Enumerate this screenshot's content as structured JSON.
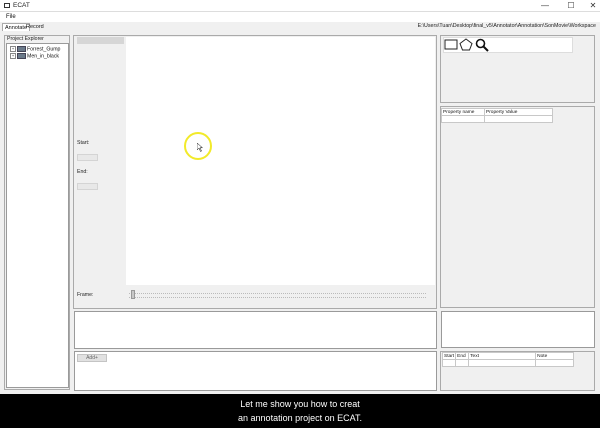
{
  "window": {
    "title": "ECAT",
    "minimize_glyph": "—",
    "maximize_glyph": "☐",
    "close_glyph": "✕"
  },
  "menu": {
    "file": "File"
  },
  "tabs": [
    {
      "label": "Annotate"
    },
    {
      "label": "Record"
    }
  ],
  "workspace_path": "E:\\Users\\Tuan\\Desktop\\final_v5\\Annotator\\Annotation\\SonMovie\\Workspace",
  "project_explorer": {
    "title": "Project Explorer",
    "items": [
      {
        "label": "Forrest_Gump"
      },
      {
        "label": "Men_in_black"
      }
    ]
  },
  "video": {
    "start_label": "Start:",
    "end_label": "End:",
    "frame_label": "Frame:"
  },
  "tools": {
    "icons": [
      "rectangle-icon",
      "polygon-icon",
      "zoom-icon"
    ]
  },
  "properties": {
    "columns": [
      "Property name",
      "Property Value"
    ]
  },
  "annotations": {
    "add_button": "Add+",
    "columns": [
      "Start",
      "End",
      "Text",
      "Note"
    ]
  },
  "subtitle": {
    "line1": "Let me show you how to creat",
    "line2": "an annotation project on ECAT."
  },
  "colors": {
    "cursor_highlight": "#f2ea2a",
    "caption_bg": "#000000"
  }
}
